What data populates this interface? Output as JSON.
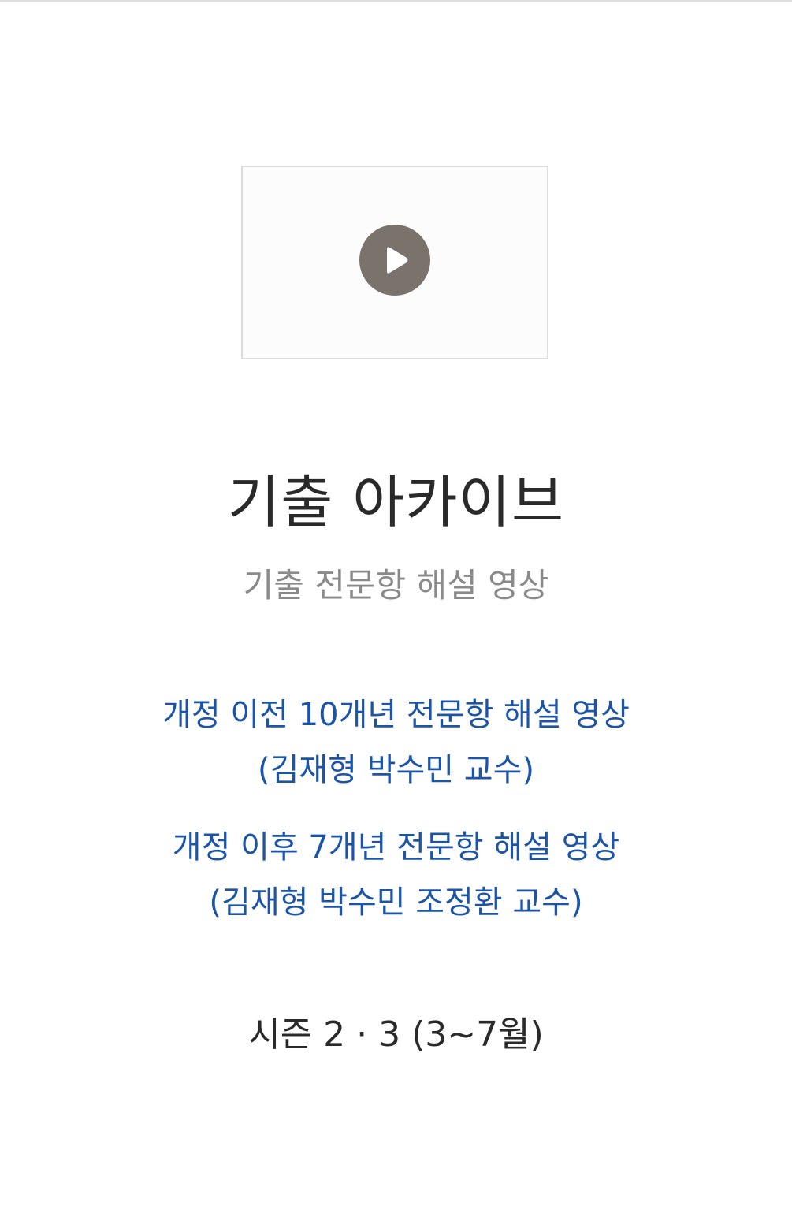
{
  "video": {
    "play_icon": "play-icon",
    "play_color": "#7a736b"
  },
  "header": {
    "title": "기출 아카이브",
    "subtitle": "기출 전문항 해설 영상"
  },
  "links": [
    {
      "line1": "개정 이전 10개년 전문항 해설 영상",
      "line2": "(김재형 박수민 교수)"
    },
    {
      "line1": "개정 이후 7개년 전문항 해설 영상",
      "line2": "(김재형 박수민 조정환 교수)"
    }
  ],
  "season": {
    "label": "시즌 2 · 3 (3~7월)"
  },
  "colors": {
    "link": "#1d55a6",
    "title": "#2a2a2a",
    "subtitle": "#8a8a8a"
  }
}
